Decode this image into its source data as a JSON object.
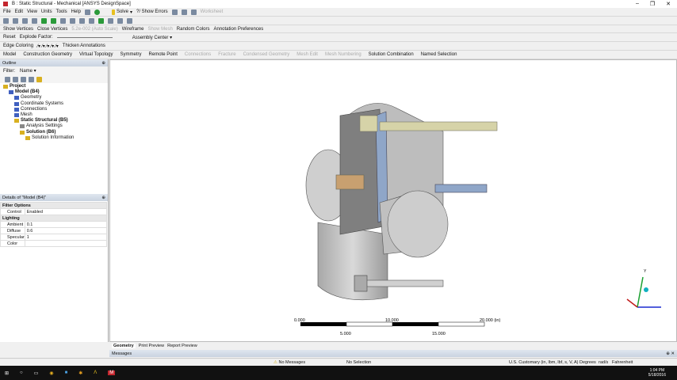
{
  "window": {
    "title": "B : Static Structural - Mechanical [ANSYS DesignSpace]"
  },
  "menu": [
    "File",
    "Edit",
    "View",
    "Units",
    "Tools",
    "Help"
  ],
  "toolbar1": {
    "solve": "Solve",
    "show_errors": "?/ Show Errors",
    "worksheet": "Worksheet"
  },
  "toolbar3": {
    "show_vertices": "Show Vertices",
    "close_vertices": "Close Vertices",
    "tolerance": "5.2e-002 (Auto Scale)",
    "wireframe": "Wireframe",
    "show_mesh": "Show Mesh",
    "random_colors": "Random Colors",
    "annotation_prefs": "Annotation Preferences"
  },
  "toolbar4": {
    "reset": "Reset",
    "explode_factor": "Explode Factor:",
    "assembly_center": "Assembly Center"
  },
  "toolbar5": {
    "edge_coloring": "Edge Coloring",
    "thicken": "Thicken Annotations"
  },
  "context_tabs": [
    {
      "label": "Model",
      "enabled": true
    },
    {
      "label": "Construction Geometry",
      "enabled": true
    },
    {
      "label": "Virtual Topology",
      "enabled": true
    },
    {
      "label": "Symmetry",
      "enabled": true
    },
    {
      "label": "Remote Point",
      "enabled": true
    },
    {
      "label": "Connections",
      "enabled": false
    },
    {
      "label": "Fracture",
      "enabled": false
    },
    {
      "label": "Condensed Geometry",
      "enabled": false
    },
    {
      "label": "Mesh Edit",
      "enabled": false
    },
    {
      "label": "Mesh Numbering",
      "enabled": false
    },
    {
      "label": "Solution Combination",
      "enabled": true
    },
    {
      "label": "Named Selection",
      "enabled": true
    }
  ],
  "outline": {
    "title": "Outline",
    "filter_label": "Filter:",
    "filter_value": "Name",
    "tree": [
      {
        "label": "Project",
        "level": 0,
        "bold": true
      },
      {
        "label": "Model (B4)",
        "level": 1,
        "bold": true
      },
      {
        "label": "Geometry",
        "level": 2,
        "bold": false
      },
      {
        "label": "Coordinate Systems",
        "level": 2,
        "bold": false
      },
      {
        "label": "Connections",
        "level": 2,
        "bold": false
      },
      {
        "label": "Mesh",
        "level": 2,
        "bold": false
      },
      {
        "label": "Static Structural (B5)",
        "level": 2,
        "bold": true
      },
      {
        "label": "Analysis Settings",
        "level": 3,
        "bold": false
      },
      {
        "label": "Solution (B6)",
        "level": 3,
        "bold": true
      },
      {
        "label": "Solution Information",
        "level": 4,
        "bold": false
      }
    ]
  },
  "details": {
    "title": "Details of \"Model (B4)\"",
    "sections": [
      {
        "name": "Filter Options",
        "rows": [
          [
            "Control",
            "Enabled"
          ]
        ]
      },
      {
        "name": "Lighting",
        "rows": [
          [
            "Ambient",
            "0.1"
          ],
          [
            "Diffuse",
            "0.6"
          ],
          [
            "Specular",
            "1"
          ],
          [
            "Color",
            ""
          ]
        ]
      }
    ]
  },
  "scale": {
    "top": [
      "0.000",
      "10.000",
      "20.000 (in)"
    ],
    "bottom": [
      "5.000",
      "15.000"
    ]
  },
  "axes": {
    "y": "Y"
  },
  "bottom_tabs": [
    "Geometry",
    "Print Preview",
    "Report Preview"
  ],
  "messages": {
    "title": "Messages"
  },
  "status": {
    "messages": "No Messages",
    "selection": "No Selection",
    "units": "U.S. Customary (in, lbm, lbf, s, V, A)",
    "angle": "Degrees",
    "rot": "rad/s",
    "temp": "Fahrenheit"
  },
  "taskbar": {
    "time": "1:04 PM",
    "date": "5/18/2016"
  },
  "colors": {
    "accent": "#0078d7",
    "part": "#c8c8c8",
    "bolt": "#d6d3a8",
    "blue_part": "#8fa6c8"
  }
}
